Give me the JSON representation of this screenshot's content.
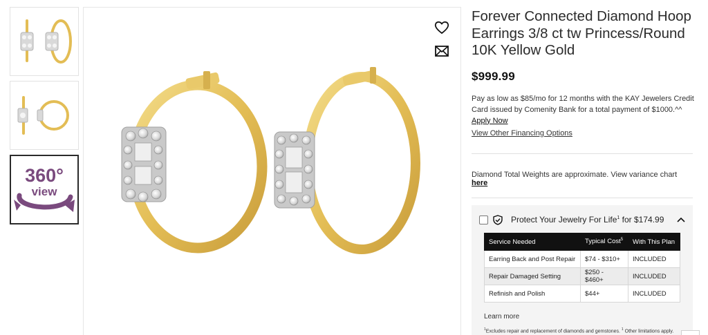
{
  "thumbnails": [
    {
      "label": "",
      "kind": "product-front"
    },
    {
      "label": "",
      "kind": "product-side"
    },
    {
      "label": "view",
      "kind": "360-view",
      "badge": "360°"
    }
  ],
  "main_image": {
    "wishlist_icon": "heart-icon",
    "share_icon": "envelope-icon"
  },
  "product": {
    "title": "Forever Connected Diamond Hoop Earrings 3/8 ct tw Princess/Round 10K Yellow Gold",
    "price": "$999.99"
  },
  "financing": {
    "text": "Pay as low as $85/mo for 12 months with the KAY Jewelers Credit Card issued by Comenity Bank for a total payment of $1000.^^",
    "apply_link": "Apply Now",
    "other_options_link": "View Other Financing Options"
  },
  "variance": {
    "text": "Diamond Total Weights are approximate. View variance chart",
    "link": "here"
  },
  "protection_plan": {
    "title": "Protect Your Jewelry For Life",
    "title_sup": "1",
    "price_text": "for $174.99",
    "table": {
      "headers": [
        "Service Needed",
        "Typical Cost",
        "With This Plan"
      ],
      "header_sup": "5",
      "rows": [
        [
          "Earring Back and Post Repair",
          "$74 - $310+",
          "INCLUDED"
        ],
        [
          "Repair Damaged Setting",
          "$250 - $460+",
          "INCLUDED"
        ],
        [
          "Refinish and Polish",
          "$44+",
          "INCLUDED"
        ]
      ]
    },
    "learn_more": "Learn more",
    "footnote_sup": "1",
    "footnote_a": "Excludes repair and replacement of diamonds and gemstones.",
    "footnote_sup2": "1",
    "footnote_b": "Other limitations apply."
  },
  "colors": {
    "gold": "#e8c25a",
    "gold_dark": "#b8912e",
    "purple_360": "#7a4a7e",
    "table_header": "#111111"
  }
}
